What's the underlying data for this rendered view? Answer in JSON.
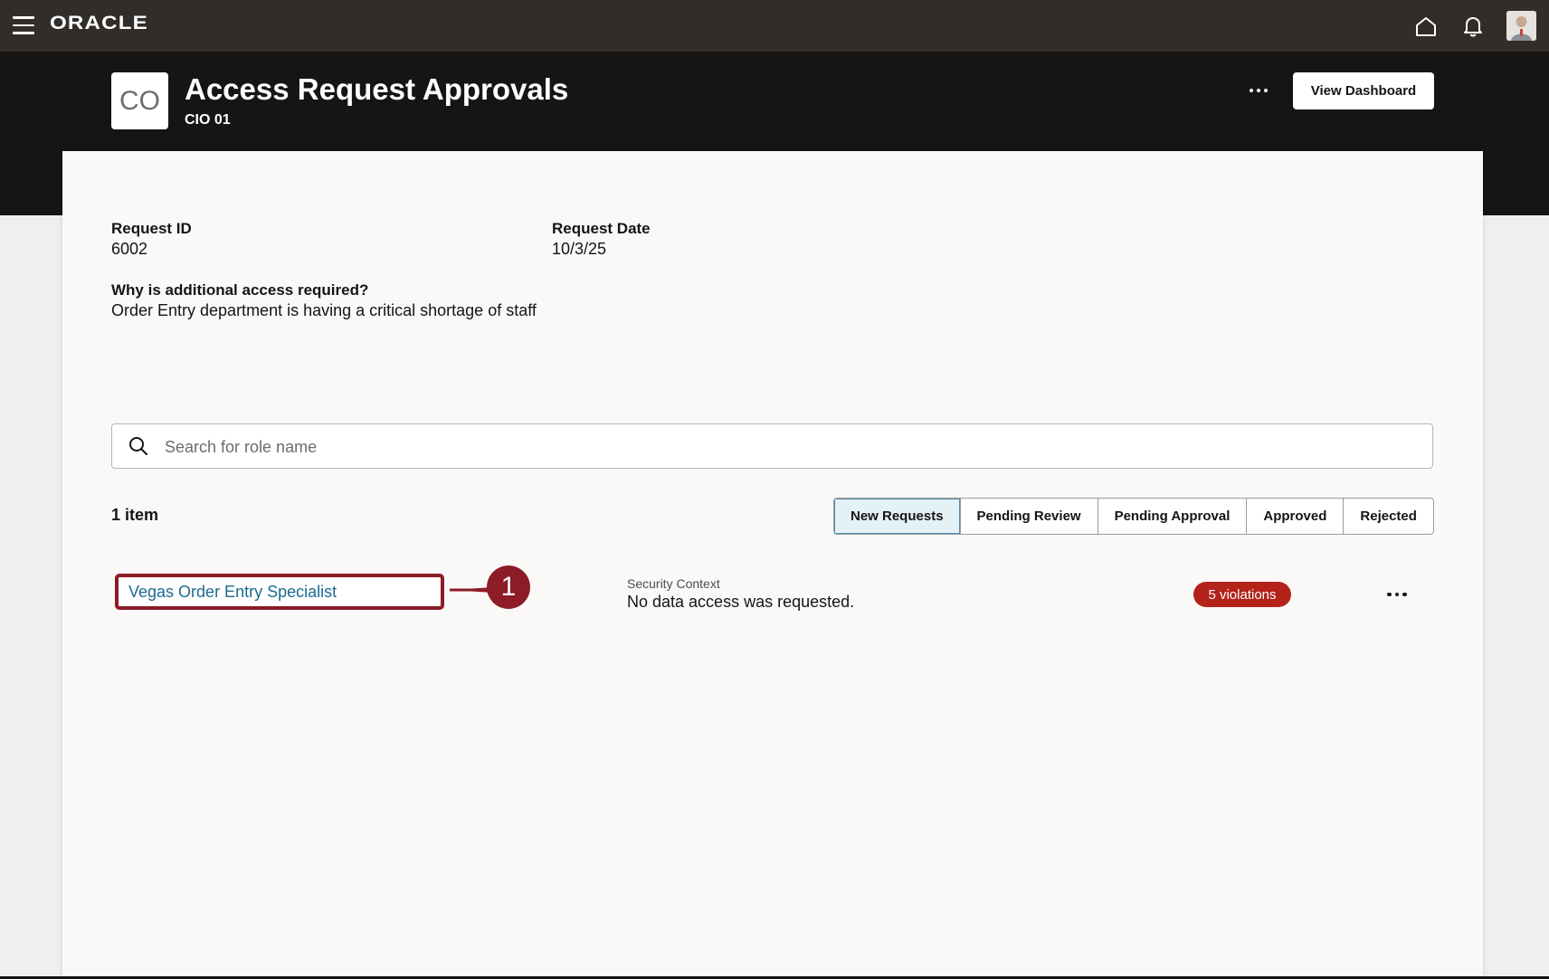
{
  "topbar": {
    "brand": "ORACLE",
    "menu_icon": "hamburger-menu-icon",
    "home_icon": "home-icon",
    "notifications_icon": "bell-icon",
    "avatar_icon": "user-avatar"
  },
  "header": {
    "logo_initials": "CO",
    "title": "Access Request Approvals",
    "subtitle": "CIO 01",
    "more_icon": "ellipsis-icon",
    "view_dashboard_label": "View Dashboard"
  },
  "request": {
    "id_label": "Request ID",
    "id_value": "6002",
    "date_label": "Request Date",
    "date_value": "10/3/25",
    "reason_label": "Why is additional access required?",
    "reason_value": "Order Entry department is having a critical shortage of staff"
  },
  "search": {
    "placeholder": "Search for role name",
    "value": "",
    "icon": "search-icon"
  },
  "list": {
    "count_label": "1 item",
    "tabs": [
      {
        "label": "New Requests",
        "active": true
      },
      {
        "label": "Pending Review",
        "active": false
      },
      {
        "label": "Pending Approval",
        "active": false
      },
      {
        "label": "Approved",
        "active": false
      },
      {
        "label": "Rejected",
        "active": false
      }
    ],
    "rows": [
      {
        "role_name": "Vegas Order Entry Specialist",
        "security_context_label": "Security Context",
        "security_context_value": "No data access was requested.",
        "violations": "5 violations"
      }
    ]
  },
  "callout": {
    "number": "1",
    "color": "#8c1c26"
  },
  "colors": {
    "topbar": "#312d2a",
    "hero": "#161513",
    "link": "#1b6a8f",
    "violation_badge": "#b3231a",
    "active_tab": "#e4f1f7"
  }
}
